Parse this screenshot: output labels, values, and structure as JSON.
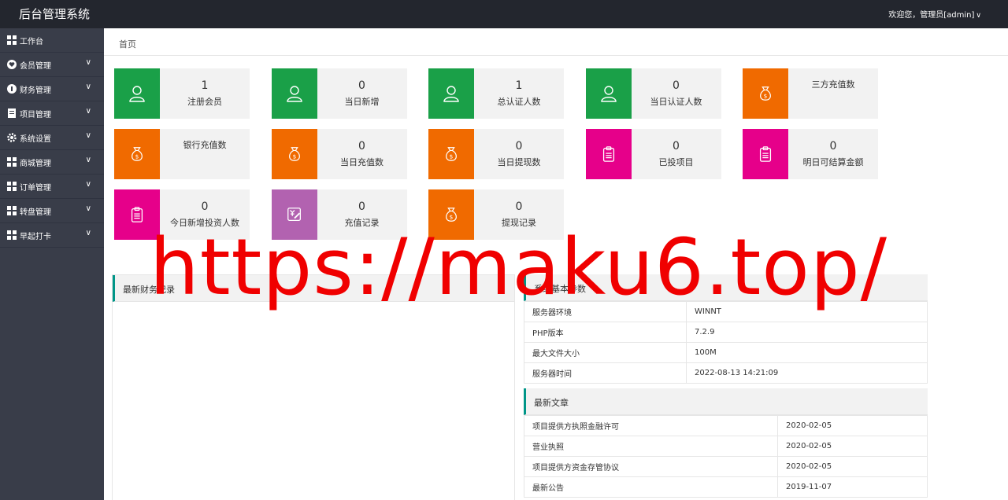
{
  "header": {
    "title": "后台管理系统",
    "user_text": "欢迎您，管理员[admin]"
  },
  "sidebar": {
    "items": [
      {
        "label": "工作台",
        "icon": "dashboard-icon",
        "has_children": false
      },
      {
        "label": "会员管理",
        "icon": "heart-icon",
        "has_children": true
      },
      {
        "label": "财务管理",
        "icon": "finance-icon",
        "has_children": true
      },
      {
        "label": "项目管理",
        "icon": "document-icon",
        "has_children": true
      },
      {
        "label": "系统设置",
        "icon": "gear-icon",
        "has_children": true
      },
      {
        "label": "商城管理",
        "icon": "grid-icon",
        "has_children": true
      },
      {
        "label": "订单管理",
        "icon": "grid-icon",
        "has_children": true
      },
      {
        "label": "转盘管理",
        "icon": "grid-icon",
        "has_children": true
      },
      {
        "label": "早起打卡",
        "icon": "grid-icon",
        "has_children": true
      }
    ]
  },
  "breadcrumb": "首页",
  "stats": [
    {
      "label": "注册会员",
      "value": "1",
      "color": "#1aa048",
      "icon": "user-icon"
    },
    {
      "label": "当日新增",
      "value": "0",
      "color": "#1aa048",
      "icon": "user-icon"
    },
    {
      "label": "总认证人数",
      "value": "1",
      "color": "#1aa048",
      "icon": "user-icon"
    },
    {
      "label": "当日认证人数",
      "value": "0",
      "color": "#1aa048",
      "icon": "user-icon"
    },
    {
      "label": "三方充值数",
      "value": "",
      "color": "#f06a00",
      "icon": "money-bag-icon"
    },
    {
      "label": "银行充值数",
      "value": "",
      "color": "#f06a00",
      "icon": "money-bag-icon"
    },
    {
      "label": "当日充值数",
      "value": "0",
      "color": "#f06a00",
      "icon": "money-bag-icon"
    },
    {
      "label": "当日提现数",
      "value": "0",
      "color": "#f06a00",
      "icon": "money-bag-icon"
    },
    {
      "label": "已投项目",
      "value": "0",
      "color": "#e6008a",
      "icon": "clipboard-icon"
    },
    {
      "label": "明日可结算金额",
      "value": "0",
      "color": "#e6008a",
      "icon": "clipboard-icon"
    },
    {
      "label": "今日新增投资人数",
      "value": "0",
      "color": "#e6008a",
      "icon": "clipboard-icon"
    },
    {
      "label": "充值记录",
      "value": "0",
      "color": "#b262b0",
      "icon": "yen-edit-icon"
    },
    {
      "label": "提现记录",
      "value": "0",
      "color": "#f06a00",
      "icon": "money-bag-icon"
    }
  ],
  "finance_panel": {
    "title": "最新财务记录"
  },
  "system_panel": {
    "title": "系统基本参数",
    "rows": [
      {
        "key": "服务器环境",
        "value": "WINNT"
      },
      {
        "key": "PHP版本",
        "value": "7.2.9"
      },
      {
        "key": "最大文件大小",
        "value": "100M"
      },
      {
        "key": "服务器时间",
        "value": "2022-08-13 14:21:09"
      }
    ]
  },
  "articles_panel": {
    "title": "最新文章",
    "rows": [
      {
        "title": "项目提供方执照金融许可",
        "date": "2020-02-05"
      },
      {
        "title": "营业执照",
        "date": "2020-02-05"
      },
      {
        "title": "项目提供方资金存管协议",
        "date": "2020-02-05"
      },
      {
        "title": "最新公告",
        "date": "2019-11-07"
      }
    ]
  },
  "watermark": "https://maku6.top/"
}
